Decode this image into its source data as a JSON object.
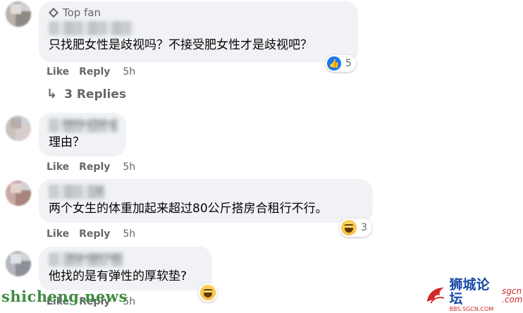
{
  "comments": [
    {
      "badge": "Top fan",
      "name_fragment": "",
      "text": "只找肥女性是歧视吗？不接受肥女性才是歧视吧？",
      "like_label": "Like",
      "reply_label": "Reply",
      "time": "5h",
      "reaction": {
        "type": "like",
        "count": "5"
      },
      "replies_label": "3 Replies"
    },
    {
      "name_fragment": "mmau tang",
      "text": "理由？",
      "like_label": "Like",
      "reply_label": "Reply",
      "time": "5h"
    },
    {
      "name_fragment": "g",
      "text": "两个女生的体重加起来超过80公斤搭房合租行不行。",
      "like_label": "Like",
      "reply_label": "Reply",
      "time": "5h",
      "reaction": {
        "type": "haha",
        "count": "3"
      }
    },
    {
      "name_fragment": "maman fan",
      "text": "他找的是有弹性的厚软垫?",
      "like_label": "Like",
      "reply_label": "Reply",
      "time": "5h",
      "reaction": {
        "type": "haha",
        "count": ""
      }
    }
  ],
  "watermark": "shicheng.news",
  "logo": {
    "main": "狮城论坛",
    "sub": "BBS.SGCN.COM",
    "side": "sgcn .com"
  },
  "icons": {
    "badge": "diamond-icon",
    "reply": "reply-arrow-icon",
    "like": "like-reaction-icon",
    "haha": "haha-reaction-icon"
  },
  "colors": {
    "bubble": "#f0f2f5",
    "meta": "#65676b",
    "like_blue": "#1877f2",
    "watermark": "#3e8d42"
  }
}
